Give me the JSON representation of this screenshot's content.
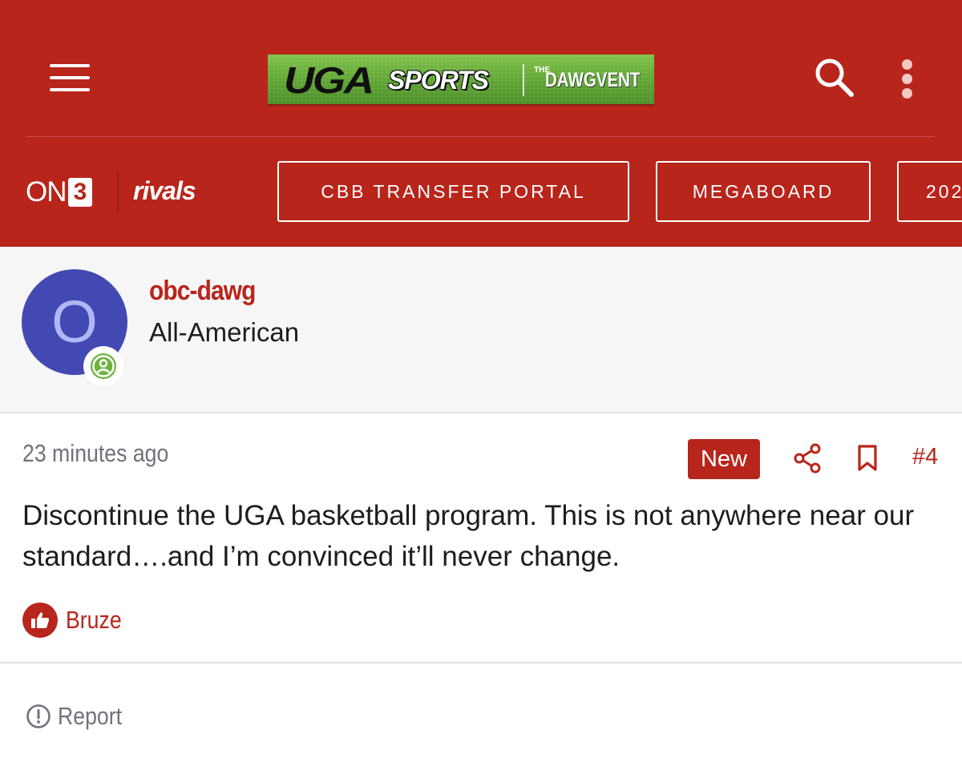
{
  "header": {
    "menu_icon": "hamburger-menu-icon",
    "logo": {
      "uga": "UGA",
      "sports": "SPORTS",
      "the": "THE",
      "dawgvent": "DAWGVENT"
    },
    "search_icon": "search-icon",
    "more_icon": "more-vertical-icon",
    "brands": {
      "on": "ON",
      "three": "3",
      "rivals": "rivals"
    },
    "nav": [
      {
        "label": "CBB TRANSFER PORTAL"
      },
      {
        "label": "MEGABOARD"
      },
      {
        "label": "202"
      }
    ]
  },
  "author": {
    "avatar_letter": "O",
    "username": "obc-dawg",
    "title": "All-American",
    "status_icon": "user-circle-icon"
  },
  "post": {
    "timestamp": "23 minutes ago",
    "badge": "New",
    "share_icon": "share-icon",
    "bookmark_icon": "bookmark-icon",
    "number": "#4",
    "body": "Discontinue the UGA basketball program. This is not anywhere near our standard….and I’m convinced it’ll never change.",
    "reaction": {
      "icon": "thumbs-up-icon",
      "user": "Bruze"
    },
    "report": {
      "icon": "alert-circle-icon",
      "label": "Report"
    }
  },
  "colors": {
    "brand_red": "#b8251b",
    "avatar_blue": "#4249b3",
    "status_green": "#6db33f",
    "muted_gray": "#6f737b"
  }
}
